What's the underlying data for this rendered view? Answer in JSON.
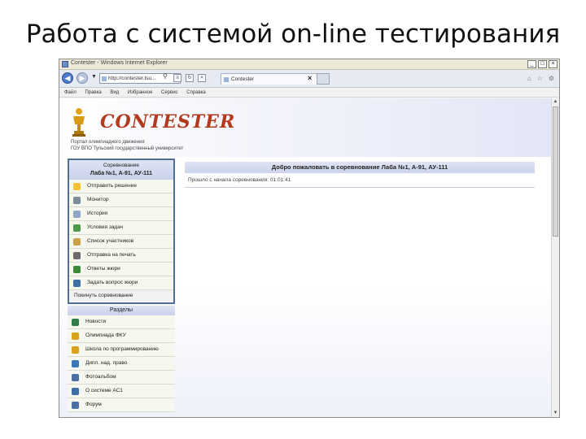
{
  "slide": {
    "title": "Работа с системой on-line тестирования"
  },
  "window": {
    "title": "Contester - Windows Internet Explorer"
  },
  "address_bar": {
    "url": "http://contester.tsu...",
    "tab_title": "Contester"
  },
  "menu": [
    "Файл",
    "Правка",
    "Вид",
    "Избранное",
    "Сервис",
    "Справка"
  ],
  "header": {
    "logo": "CONTESTER",
    "subtitle_line1": "Портал олимпиадного движения",
    "subtitle_line2": "ГОУ ВПО Тульский государственный университет"
  },
  "competition": {
    "heading": "Соревнование",
    "name": "Лаба №1, А-91, АУ-111",
    "items": [
      {
        "label": "Отправить решение",
        "icon": "lightbulb-icon",
        "color": "#f2c230"
      },
      {
        "label": "Монитор",
        "icon": "monitor-icon",
        "color": "#7d8c99"
      },
      {
        "label": "История",
        "icon": "tag-icon",
        "color": "#8fa7c4"
      },
      {
        "label": "Условия задач",
        "icon": "document-icon",
        "color": "#4d9a4d"
      },
      {
        "label": "Список участников",
        "icon": "people-icon",
        "color": "#c9a24a"
      },
      {
        "label": "Отправка на печать",
        "icon": "printer-icon",
        "color": "#6b6b6b"
      },
      {
        "label": "Ответы жюри",
        "icon": "download-icon",
        "color": "#3a8a3a"
      },
      {
        "label": "Задать вопрос жюри",
        "icon": "help-icon",
        "color": "#3c6ea8"
      }
    ],
    "leave": "Покинуть соревнование"
  },
  "sections": {
    "heading": "Разделы",
    "items": [
      {
        "label": "Новости",
        "icon": "globe-icon",
        "color": "#2f7d4a"
      },
      {
        "label": "Олимпиада ФКУ",
        "icon": "trophy-icon",
        "color": "#d9a21b"
      },
      {
        "label": "Школа по программированию",
        "icon": "trophy-icon",
        "color": "#d9a21b"
      },
      {
        "label": "Дипл. над. право",
        "icon": "chart-icon",
        "color": "#3a78b8"
      },
      {
        "label": "Фотоальбом",
        "icon": "camera-icon",
        "color": "#4b6fa5"
      },
      {
        "label": "О системе АС1",
        "icon": "help-icon",
        "color": "#3c6ea8"
      },
      {
        "label": "Форум",
        "icon": "forum-icon",
        "color": "#4b6fa5"
      }
    ]
  },
  "main": {
    "welcome": "Добро пожаловать в соревнование Лаба №1, А-91, АУ-111",
    "elapsed": "Прошло с начала соревнования: 01:01:41"
  }
}
